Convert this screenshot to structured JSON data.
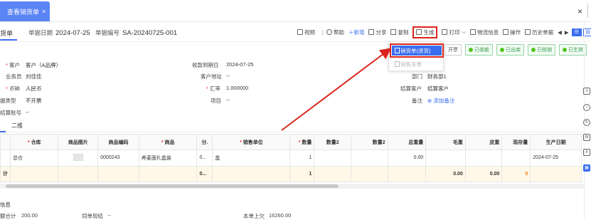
{
  "tabbar": {
    "active_tab": "查看销货单",
    "close_tab": "×",
    "window_close": "×"
  },
  "header": {
    "title": "货单",
    "date_label": "单据日期",
    "date_value": "2024-07-25",
    "no_label": "单据编号",
    "no_value": "SA-20240725-001"
  },
  "toolbar": {
    "video": "视频",
    "help": "帮助",
    "new": "新增",
    "share": "分享",
    "copy": "复制",
    "generate": "生成",
    "print": "打印",
    "logistics": "物流信息",
    "operation": "操作",
    "history": "历史单据"
  },
  "dropdown": {
    "item1": "销货单(退货)",
    "item2": "销售发票"
  },
  "status": {
    "invoice": "开票",
    "received": "已收款",
    "outbound": "已出库",
    "verified": "已核销",
    "effective": "已生效",
    "colors": {
      "green": "#389e4b",
      "blue": "#3a6df0",
      "red": "#d9251c"
    }
  },
  "form": {
    "customer_label": "客户",
    "customer_value": "客户（A品牌）",
    "salesman_label": "业务员",
    "salesman_value": "刘佳佳",
    "currency_label": "币种",
    "currency_value": "人民币",
    "doc_type_label": "据类型",
    "doc_type_value": "不开票",
    "settle_acc_label": "结算账号",
    "settle_acc_value": "--",
    "due_label": "收款到期日",
    "due_value": "2024-07-25",
    "addr_label": "客户地址",
    "addr_value": "--",
    "rate_label": "汇率",
    "rate_value": "1.000000",
    "project_label": "项目",
    "project_value": "--",
    "dept_label": "部门",
    "dept_value": "财务部1",
    "settle_cust_label": "结算客户",
    "settle_cust_value": "结算客户",
    "note_label": "备注",
    "note_value": "添加备注"
  },
  "subtabs": {
    "t1": "",
    "t2": "二维"
  },
  "table": {
    "headers": [
      "仓库",
      "商品图片",
      "商品编码",
      "商品",
      "分.",
      "销售单位",
      "数量",
      "数量2",
      "数量2",
      "总重量",
      "毛重",
      "皮重",
      "现存量",
      "生产日期"
    ],
    "row": [
      "总仓",
      "",
      "0000243",
      "养麦面礼盒装",
      "0...",
      "盒",
      "1",
      "",
      "",
      "0.00",
      "",
      "",
      "",
      "2024-07-25"
    ],
    "sum": {
      "label": "计",
      "unit": "0...",
      "qty": "1",
      "gross": "0.00",
      "tare": "0.00",
      "stock": "0"
    }
  },
  "footer": {
    "section": "信息",
    "total_label": "额合计",
    "total_value": "200.00",
    "sync_label": "同单现结",
    "sync_value": "--",
    "debt_label": "本单上欠",
    "debt_value": "16260.00"
  },
  "sidebar": [
    "doc-icon",
    "info-icon",
    "refresh-icon",
    "settings-icon",
    "link-icon",
    "grid-icon"
  ]
}
